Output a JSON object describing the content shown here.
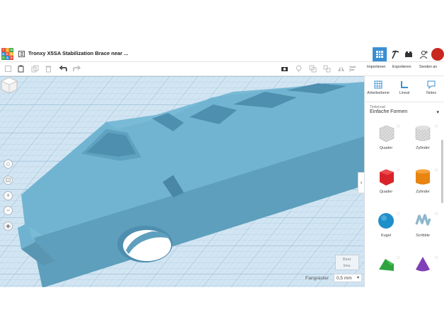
{
  "logo": {
    "letters": [
      "T",
      "I",
      "N",
      "K",
      "E",
      "R",
      "C",
      "A",
      "D"
    ]
  },
  "document": {
    "title": "Tronxy X5SA Stabilization Brace near ..."
  },
  "topbar": {
    "grid_view_icon": "grid-icon",
    "build_icon": "pickaxe-icon",
    "bricks_icon": "bricks-icon",
    "user_icon": "user-add-icon"
  },
  "actions": {
    "import": "Importieren",
    "export": "Exportieren",
    "send": "Senden an"
  },
  "toolbar": {
    "icons": [
      "new-shape-icon",
      "paste-icon",
      "duplicate-icon",
      "delete-icon",
      "undo-icon",
      "redo-icon",
      "camera-icon",
      "light-icon",
      "group-icon",
      "ungroup-icon",
      "mirror-icon",
      "align-icon"
    ]
  },
  "panel": {
    "tabs": [
      {
        "label": "Arbeitsebene",
        "icon": "workplane-icon"
      },
      {
        "label": "Lineal",
        "icon": "ruler-icon"
      },
      {
        "label": "Notes",
        "icon": "notes-icon"
      }
    ],
    "library_source": "Tinkercad",
    "library_name": "Einfache Formen",
    "shapes": [
      {
        "label": "Quader",
        "icon": "box-striped-icon"
      },
      {
        "label": "Zylinder",
        "icon": "cylinder-striped-icon"
      },
      {
        "label": "Quader",
        "icon": "box-red-icon"
      },
      {
        "label": "Zylinder",
        "icon": "cylinder-orange-icon"
      },
      {
        "label": "Kugel",
        "icon": "sphere-blue-icon"
      },
      {
        "label": "Scribble",
        "icon": "scribble-icon"
      },
      {
        "label": "",
        "icon": "roof-green-icon"
      },
      {
        "label": "",
        "icon": "cone-purple-icon"
      }
    ]
  },
  "viewport": {
    "settings_line1": "Rast.",
    "settings_line2": "bea.",
    "snap_label": "Fangraster",
    "snap_value": "0,5 mm"
  },
  "colors": {
    "accent": "#3a8fd3",
    "object": "#6fb6d4",
    "grid": "#c7dded",
    "red_box": "#d9232b",
    "orange_cyl": "#e8840f",
    "blue_sphere": "#1f8fc9",
    "green_roof": "#2ea43f",
    "purple_cone": "#7f3fb5"
  }
}
